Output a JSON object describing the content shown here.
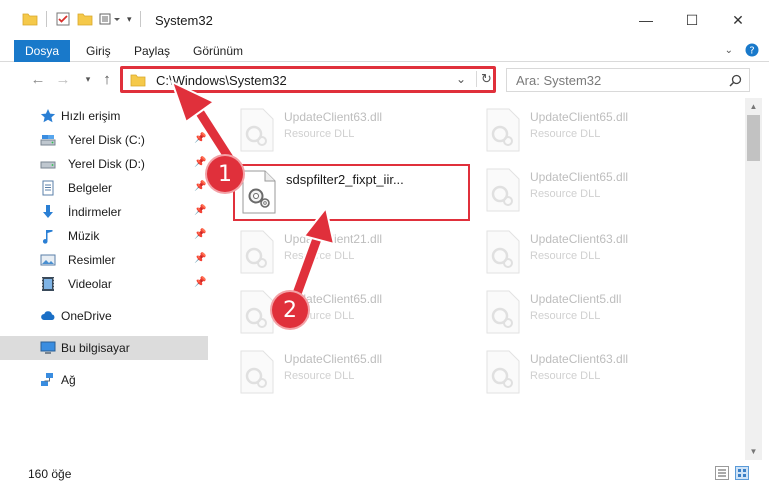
{
  "window": {
    "title": "System32",
    "minimize": "—",
    "maximize": "☐",
    "close": "✕"
  },
  "ribbon": {
    "tabs": [
      "Dosya",
      "Giriş",
      "Paylaş",
      "Görünüm"
    ]
  },
  "address": {
    "path": "C:\\Windows\\System32"
  },
  "search": {
    "placeholder": "Ara: System32"
  },
  "nav": {
    "quick_access": "Hızlı erişim",
    "items": [
      {
        "label": "Yerel Disk (C:)",
        "icon": "drive-icon"
      },
      {
        "label": "Yerel Disk (D:)",
        "icon": "drive-icon"
      },
      {
        "label": "Belgeler",
        "icon": "documents-icon"
      },
      {
        "label": "İndirmeler",
        "icon": "downloads-icon"
      },
      {
        "label": "Müzik",
        "icon": "music-icon"
      },
      {
        "label": "Resimler",
        "icon": "pictures-icon"
      },
      {
        "label": "Videolar",
        "icon": "videos-icon"
      }
    ],
    "onedrive": "OneDrive",
    "this_pc": "Bu bilgisayar",
    "network": "Ağ"
  },
  "files": [
    {
      "name": "UpdateClient63.dll",
      "type": "Resource DLL"
    },
    {
      "name": "UpdateClient65.dll",
      "type": "Resource DLL"
    },
    {
      "name": "sdspfilter2_fixpt_iir...",
      "type": ""
    },
    {
      "name": "UpdateClient65.dll",
      "type": "Resource DLL"
    },
    {
      "name": "UpdateClient21.dll",
      "type": "Resource DLL"
    },
    {
      "name": "UpdateClient63.dll",
      "type": "Resource DLL"
    },
    {
      "name": "UpdateClient65.dll",
      "type": "Resource DLL"
    },
    {
      "name": "UpdateClient5.dll",
      "type": "Resource DLL"
    },
    {
      "name": "UpdateClient65.dll",
      "type": "Resource DLL"
    },
    {
      "name": "UpdateClient63.dll",
      "type": "Resource DLL"
    }
  ],
  "status": {
    "count": "160 öğe"
  },
  "annotations": {
    "step1": "1",
    "step2": "2"
  },
  "colors": {
    "accent": "#1979ca",
    "highlight": "#e0303b",
    "selected_bg": "#dcdcdc"
  }
}
